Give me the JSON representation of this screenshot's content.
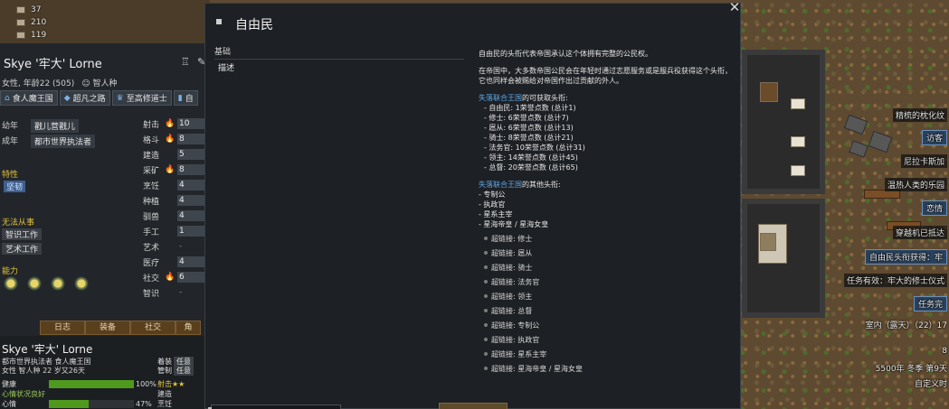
{
  "resources": [
    {
      "icon": "resource-icon",
      "value": "37"
    },
    {
      "icon": "resource-icon",
      "value": "210"
    },
    {
      "icon": "resource-icon",
      "value": "119"
    }
  ],
  "pawn": {
    "name": "Skye '牢大' Lorne",
    "info": "女性, 年龄22 (505)",
    "race": "智人种",
    "tags": [
      {
        "icon": "faction-icon",
        "label": "食人魔王国"
      },
      {
        "icon": "ideology-icon",
        "label": "超凡之路"
      },
      {
        "icon": "title-icon",
        "label": "至高修道士"
      },
      {
        "icon": "book-icon",
        "label": "自"
      }
    ],
    "childhood_label": "幼年",
    "childhood": "戳儿营戳儿",
    "adulthood_label": "成年",
    "adulthood": "都市世界执法者",
    "traits_header": "特性",
    "trait": "坚韧",
    "incapable_header": "无法从事",
    "incapable": [
      "智识工作",
      "艺术工作"
    ],
    "abilities_header": "能力",
    "skills": [
      {
        "name": "射击",
        "flame": "🔥",
        "value": "10"
      },
      {
        "name": "格斗",
        "flame": "🔥",
        "value": "8"
      },
      {
        "name": "建造",
        "flame": "",
        "value": "5"
      },
      {
        "name": "采矿",
        "flame": "🔥",
        "value": "8"
      },
      {
        "name": "烹饪",
        "flame": "",
        "value": "4"
      },
      {
        "name": "种植",
        "flame": "",
        "value": "4"
      },
      {
        "name": "驯兽",
        "flame": "",
        "value": "4"
      },
      {
        "name": "手工",
        "flame": "",
        "value": "1"
      },
      {
        "name": "艺术",
        "flame": "",
        "value": "-"
      },
      {
        "name": "医疗",
        "flame": "",
        "value": "4"
      },
      {
        "name": "社交",
        "flame": "🔥",
        "value": "6"
      },
      {
        "name": "智识",
        "flame": "",
        "value": "-"
      }
    ],
    "tabs": [
      "日志",
      "装备",
      "社交",
      "角"
    ]
  },
  "bottom": {
    "name": "Skye '牢大' Lorne",
    "line1": "都市世界执法者 食人魔王国",
    "line2": "女性 智人种 22 岁又26天",
    "box1_label": "着装",
    "box1_value": "任意",
    "box2_label": "管制",
    "box2_value": "任意",
    "bars": [
      {
        "label": "健康",
        "percent": "100%",
        "fill": 1.0,
        "status": "射击★★"
      },
      {
        "label": "心情状况良好",
        "percent": "",
        "fill": 0,
        "status": "建造"
      },
      {
        "label": "心情",
        "percent": "47%",
        "fill": 0.47,
        "status": "烹饪"
      }
    ]
  },
  "dialog": {
    "title": "自由民",
    "tab_group": "基础",
    "tab_item": "描述",
    "desc_p1": "自由民的头衔代表帝国承认这个体拥有完整的公民权。",
    "desc_p2": "在帝国中，大多数帝国公民会在年轻时通过志愿服务或是服兵役获得这个头衔，它也同样会被赐给对帝国作出过贡献的外人。",
    "faction_name": "失落联合王国",
    "obtainable_suffix": "的可获取头衔:",
    "obtainable": [
      "- 自由民: 1荣誉点数 (总计1)",
      "- 修士: 6荣誉点数 (总计7)",
      "- 扈从: 6荣誉点数 (总计13)",
      "- 骑士: 8荣誉点数 (总计21)",
      "- 法务官: 10荣誉点数 (总计31)",
      "- 领主: 14荣誉点数 (总计45)",
      "- 总督: 20荣誉点数 (总计65)"
    ],
    "other_suffix": "的其他头衔:",
    "other": [
      "- 专制公",
      "- 执政官",
      "- 星系主宰",
      "- 星海帝皇 / 星海女皇"
    ],
    "links": [
      "超链接: 修士",
      "超链接: 扈从",
      "超链接: 骑士",
      "超链接: 法务官",
      "超链接: 领主",
      "超链接: 总督",
      "超链接: 专制公",
      "超链接: 执政官",
      "超链接: 星系主宰",
      "超链接: 星海帝皇 / 星海女皇"
    ]
  },
  "map_labels": {
    "l1": "精梳的枕化纹",
    "l2": "访客",
    "l3": "尼拉卡斯加",
    "l4": "温热人类的乐园",
    "l5": "恋情",
    "l6": "穿越机已抵达",
    "l7": "自由民头衔获得：牢",
    "l8": "任务有效：牢大的修士仪式",
    "l9": "任务完",
    "l10": "室内（露天）（22）17",
    "l11": "8",
    "l12": "5500年 冬季 第9天",
    "l13": "自定义时"
  }
}
